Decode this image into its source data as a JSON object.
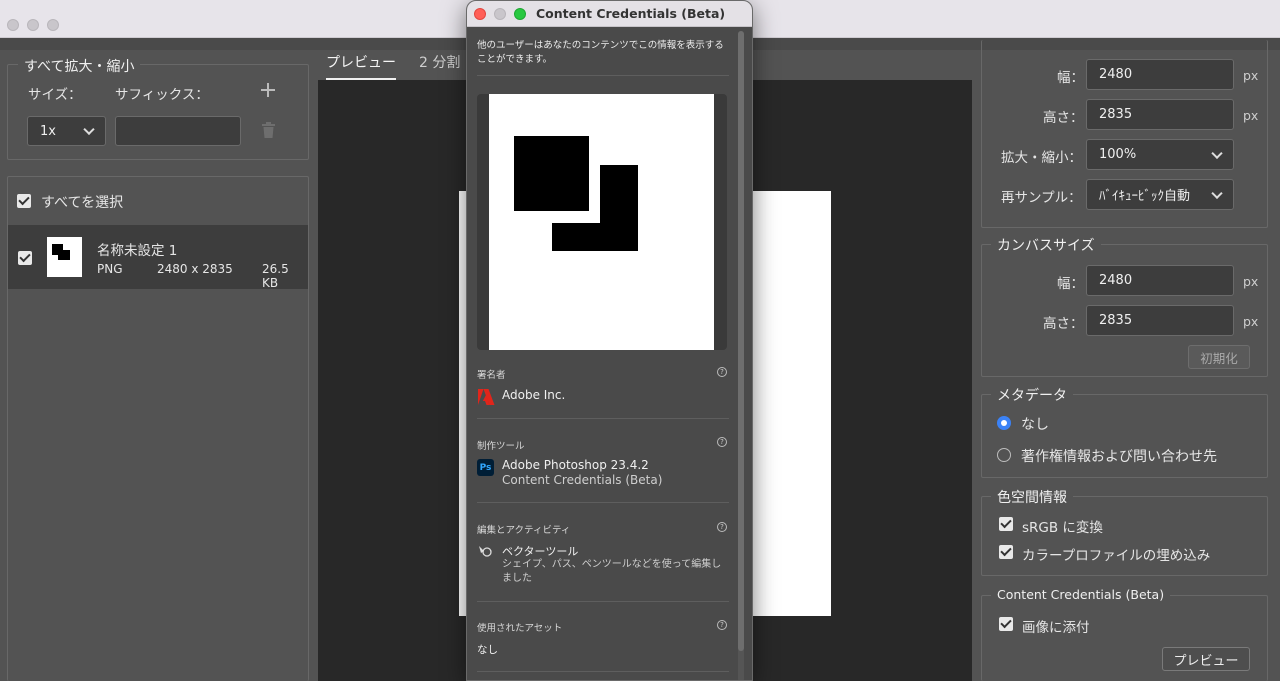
{
  "popup": {
    "title": "Content Credentials (Beta)",
    "intro": "他のユーザーはあなたのコンテンツでこの情報を表示することができます。",
    "signer_section": "署名者",
    "signer_name": "Adobe Inc.",
    "tool_section": "制作ツール",
    "tool_name": "Adobe Photoshop 23.4.2",
    "tool_sub": "Content Credentials (Beta)",
    "edits_section": "編集とアクティビティ",
    "edit_name": "ベクターツール",
    "edit_desc": "シェイプ、パス、ペンツールなどを使って編集しました",
    "assets_section": "使用されたアセット",
    "assets_value": "なし",
    "ps_icon": "Ps",
    "help_glyph": "?"
  },
  "left": {
    "scale_all_legend": "すべて拡大・縮小",
    "size_label": "サイズ：",
    "suffix_label": "サフィックス：",
    "size_value": "1x",
    "suffix_value": "",
    "select_all": "すべてを選択",
    "file": {
      "name": "名称未設定 1",
      "format": "PNG",
      "dimensions": "2480 x 2835",
      "size": "26.5 KB"
    }
  },
  "tabs": {
    "preview": "プレビュー",
    "split": "2 分割"
  },
  "right": {
    "image_size": {
      "width_label": "幅：",
      "width_value": "2480",
      "height_label": "高さ：",
      "height_value": "2835",
      "scale_label": "拡大・縮小：",
      "scale_value": "100%",
      "resample_label": "再サンプル：",
      "resample_value": "ﾊﾞｲｷｭｰﾋﾞｯｸ自動",
      "unit": "px"
    },
    "canvas": {
      "legend": "カンバスサイズ",
      "width_label": "幅：",
      "width_value": "2480",
      "height_label": "高さ：",
      "height_value": "2835",
      "reset": "初期化",
      "unit": "px"
    },
    "metadata": {
      "legend": "メタデータ",
      "none": "なし",
      "copyright": "著作権情報および問い合わせ先"
    },
    "color_space": {
      "legend": "色空間情報",
      "srgb": "sRGB に変換",
      "embed": "カラープロファイルの埋め込み"
    },
    "credentials": {
      "legend": "Content Credentials (Beta)",
      "attach": "画像に添付",
      "preview_btn": "プレビュー"
    }
  },
  "colors": {
    "bg": "#535353",
    "preview_bg": "#282828",
    "radio_accent": "#3b82f6",
    "adobe_red": "#e1251b",
    "ps_blue": "#31a8ff",
    "ps_bg": "#001e36"
  }
}
